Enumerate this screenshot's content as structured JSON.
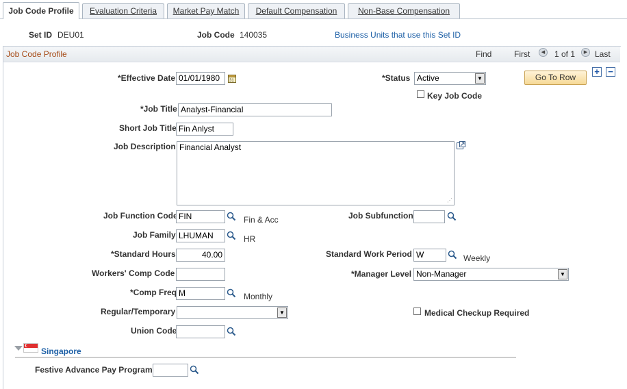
{
  "tabs": [
    {
      "label": "Job Code Profile",
      "active": true
    },
    {
      "label": "Evaluation Criteria",
      "active": false
    },
    {
      "label": "Market Pay Match",
      "active": false
    },
    {
      "label": "Default Compensation",
      "active": false
    },
    {
      "label": "Non-Base Compensation",
      "active": false
    }
  ],
  "header": {
    "setid_label": "Set ID",
    "setid_value": "DEU01",
    "jobcode_label": "Job Code",
    "jobcode_value": "140035",
    "bu_link": "Business Units that use this Set ID"
  },
  "scroll": {
    "title": "Job Code Profile",
    "find": "Find",
    "first": "First",
    "count": "1 of 1",
    "last": "Last"
  },
  "form": {
    "effective_date_label": "*Effective Date",
    "effective_date": "01/01/1980",
    "status_label": "*Status",
    "status": "Active",
    "go_to_row": "Go To Row",
    "key_job_code_label": "Key Job Code",
    "job_title_label": "*Job Title",
    "job_title": "Analyst-Financial",
    "short_title_label": "Short Job Title",
    "short_title": "Fin Anlyst",
    "job_desc_label": "Job Description",
    "job_desc": "Financial Analyst",
    "job_function_label": "Job Function Code",
    "job_function": "FIN",
    "job_function_desc": "Fin & Acc",
    "job_subfunction_label": "Job Subfunction",
    "job_subfunction": "",
    "job_family_label": "Job Family",
    "job_family": "LHUMAN",
    "job_family_desc": "HR",
    "std_hours_label": "*Standard Hours",
    "std_hours": "40.00",
    "std_work_period_label": "Standard Work Period",
    "std_work_period": "W",
    "std_work_period_desc": "Weekly",
    "workers_comp_label": "Workers' Comp Code",
    "workers_comp": "",
    "manager_level_label": "*Manager Level",
    "manager_level": "Non-Manager",
    "comp_freq_label": "*Comp Freq",
    "comp_freq": "M",
    "comp_freq_desc": "Monthly",
    "reg_temp_label": "Regular/Temporary",
    "reg_temp": "",
    "medical_label": "Medical Checkup Required",
    "union_label": "Union Code",
    "union_code": "",
    "country_section": "Singapore",
    "festive_label": "Festive Advance Pay Program",
    "festive": ""
  },
  "colors": {
    "link": "#1c5fa6",
    "section_title": "#a54a16",
    "button_bg": "#f6d996"
  },
  "icons": {
    "calendar": "calendar-icon",
    "lookup": "magnifier-icon",
    "expand_textarea": "expand-icon",
    "flag": "singapore-flag-icon",
    "collapse": "triangle-down-icon"
  }
}
